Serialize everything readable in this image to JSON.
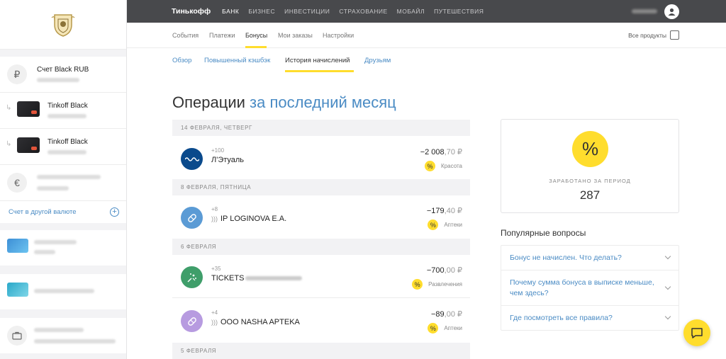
{
  "header": {
    "brand": "Тинькофф",
    "nav": [
      {
        "label": "БАНК",
        "active": true
      },
      {
        "label": "БИЗНЕС",
        "active": false
      },
      {
        "label": "ИНВЕСТИЦИИ",
        "active": false
      },
      {
        "label": "СТРАХОВАНИЕ",
        "active": false
      },
      {
        "label": "МОБАЙЛ",
        "active": false
      },
      {
        "label": "ПУТЕШЕСТВИЯ",
        "active": false
      }
    ]
  },
  "subnav": {
    "tabs": [
      "События",
      "Платежи",
      "Бонусы",
      "Мои заказы",
      "Настройки"
    ],
    "active": "Бонусы",
    "all_products": "Все продукты"
  },
  "bonus_tabs": {
    "tabs": [
      "Обзор",
      "Повышенный кэшбэк",
      "История начислений",
      "Друзьям"
    ],
    "active": "История начислений"
  },
  "sidebar": {
    "account_title": "Счет Black RUB",
    "account_symbol": "₽",
    "cards": [
      "Tinkoff Black",
      "Tinkoff Black"
    ],
    "euro_symbol": "€",
    "other_currency": "Счет в другой валюте"
  },
  "main": {
    "title_part1": "Операции",
    "title_part2": "за последний месяц",
    "groups": [
      {
        "date": "14 ФЕВРАЛЯ, ЧЕТВЕРГ"
      },
      {
        "date": "8 ФЕВРАЛЯ, ПЯТНИЦА"
      },
      {
        "date": "6 ФЕВРАЛЯ"
      },
      {
        "date": "5 ФЕВРАЛЯ"
      }
    ],
    "operations": [
      {
        "points": "+100",
        "name": "Л'Этуаль",
        "amount_int": "−2 008",
        "amount_dec": ",70 ₽",
        "category": "Красота",
        "color": "#0a4a8c"
      },
      {
        "points": "+8",
        "name": "IP LOGINOVA E.A.",
        "amount_int": "−179",
        "amount_dec": ",40 ₽",
        "category": "Аптеки",
        "color": "#5b9bd5"
      },
      {
        "points": "+35",
        "name": "TICKETS",
        "amount_int": "−700",
        "amount_dec": ",00 ₽",
        "category": "Развлечения",
        "color": "#3f9e6a"
      },
      {
        "points": "+4",
        "name": "OOO NASHA APTEKA",
        "amount_int": "−89",
        "amount_dec": ",00 ₽",
        "category": "Аптеки",
        "color": "#b79be0"
      }
    ]
  },
  "earned": {
    "icon": "%",
    "label": "ЗАРАБОТАНО ЗА ПЕРИОД",
    "value": "287"
  },
  "faq": {
    "title": "Популярные вопросы",
    "items": [
      "Бонус не начислен. Что делать?",
      "Почему сумма бонуса в выписке меньше, чем здесь?",
      "Где посмотреть все правила?"
    ]
  },
  "colors": {
    "accent": "#ffdd2d",
    "link": "#4a8bc4",
    "topbar": "#48494c"
  }
}
